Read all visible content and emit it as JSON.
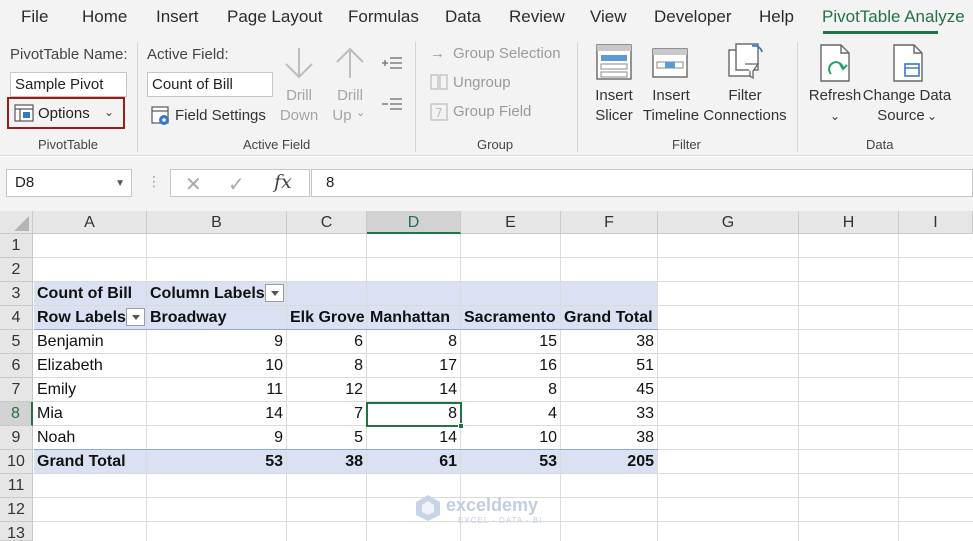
{
  "menu": {
    "items": [
      "File",
      "Home",
      "Insert",
      "Page Layout",
      "Formulas",
      "Data",
      "Review",
      "View",
      "Developer",
      "Help",
      "PivotTable Analyze"
    ]
  },
  "ribbon": {
    "pivottable": {
      "name_label": "PivotTable Name:",
      "name_value": "Sample Pivot",
      "options_label": "Options",
      "group_label": "PivotTable"
    },
    "active_field": {
      "label": "Active Field:",
      "value": "Count of Bill",
      "field_settings": "Field Settings",
      "drill_down_1": "Drill",
      "drill_down_2": "Down",
      "drill_up_1": "Drill",
      "drill_up_2": "Up",
      "group_label": "Active Field"
    },
    "group": {
      "group_selection": "Group Selection",
      "ungroup": "Ungroup",
      "group_field": "Group Field",
      "group_label": "Group"
    },
    "filter": {
      "insert_slicer_1": "Insert",
      "insert_slicer_2": "Slicer",
      "insert_timeline_1": "Insert",
      "insert_timeline_2": "Timeline",
      "filter_connections_1": "Filter",
      "filter_connections_2": "Connections",
      "group_label": "Filter"
    },
    "data": {
      "refresh": "Refresh",
      "change_source_1": "Change Data",
      "change_source_2": "Source",
      "group_label": "Data"
    }
  },
  "formula_bar": {
    "name_box": "D8",
    "formula": "8",
    "fx": "fx"
  },
  "grid": {
    "columns": [
      "A",
      "B",
      "C",
      "D",
      "E",
      "F",
      "G",
      "H",
      "I"
    ],
    "rows": [
      "1",
      "2",
      "3",
      "4",
      "5",
      "6",
      "7",
      "8",
      "9",
      "10",
      "11",
      "12",
      "13"
    ],
    "selected_column": "D",
    "selected_row": "8"
  },
  "pivot": {
    "value_field": "Count of Bill",
    "column_labels": "Column Labels",
    "row_labels": "Row Labels",
    "headers": [
      "Broadway",
      "Elk Grove",
      "Manhattan",
      "Sacramento",
      "Grand Total"
    ],
    "rows": [
      {
        "name": "Benjamin",
        "values": [
          "9",
          "6",
          "8",
          "15",
          "38"
        ]
      },
      {
        "name": "Elizabeth",
        "values": [
          "10",
          "8",
          "17",
          "16",
          "51"
        ]
      },
      {
        "name": "Emily",
        "values": [
          "11",
          "12",
          "14",
          "8",
          "45"
        ]
      },
      {
        "name": "Mia",
        "values": [
          "14",
          "7",
          "8",
          "4",
          "33"
        ]
      },
      {
        "name": "Noah",
        "values": [
          "9",
          "5",
          "14",
          "10",
          "38"
        ]
      }
    ],
    "grand_total_label": "Grand Total",
    "grand_total_values": [
      "53",
      "38",
      "61",
      "53",
      "205"
    ]
  },
  "watermark": {
    "brand": "exceldemy",
    "tagline": "EXCEL · DATA · BI"
  },
  "colors": {
    "accent": "#217346",
    "pivot_band": "#d9e1f2",
    "highlight_border": "#9c1c1c"
  }
}
